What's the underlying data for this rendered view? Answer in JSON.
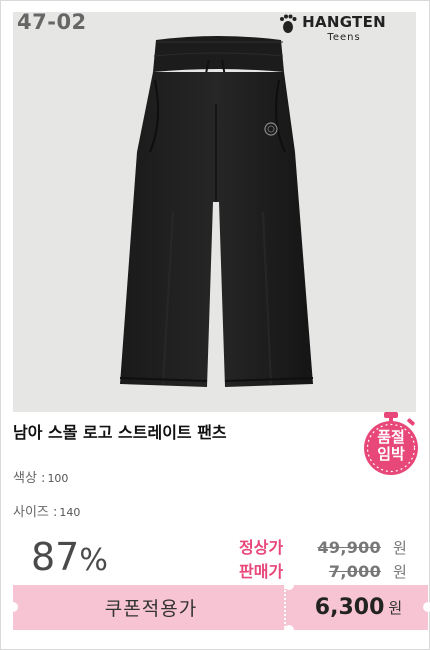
{
  "product": {
    "code": "47-02",
    "brand_name": "HANGTEN",
    "brand_sub": "Teens",
    "title": "남아 스몰 로고 스트레이트 팬츠",
    "badge": [
      "품절",
      "임박"
    ],
    "color_label": "색상 :",
    "color_value": "100",
    "size_label": "사이즈 :",
    "size_value": "140"
  },
  "pricing": {
    "discount_number": "87",
    "discount_symbol": "%",
    "regular_label": "정상가",
    "regular_price": "49,900",
    "sale_label": "판매가",
    "sale_price": "7,000",
    "currency": "원"
  },
  "coupon": {
    "label": "쿠폰적용가",
    "price": "6,300",
    "currency": "원"
  },
  "colors": {
    "accent_pink": "#e8477a",
    "coupon_bg": "#f6c4d2",
    "photo_bg": "#e6e6e4"
  },
  "icons": {
    "brand": "footprint-icon",
    "badge": "stopwatch-icon"
  }
}
